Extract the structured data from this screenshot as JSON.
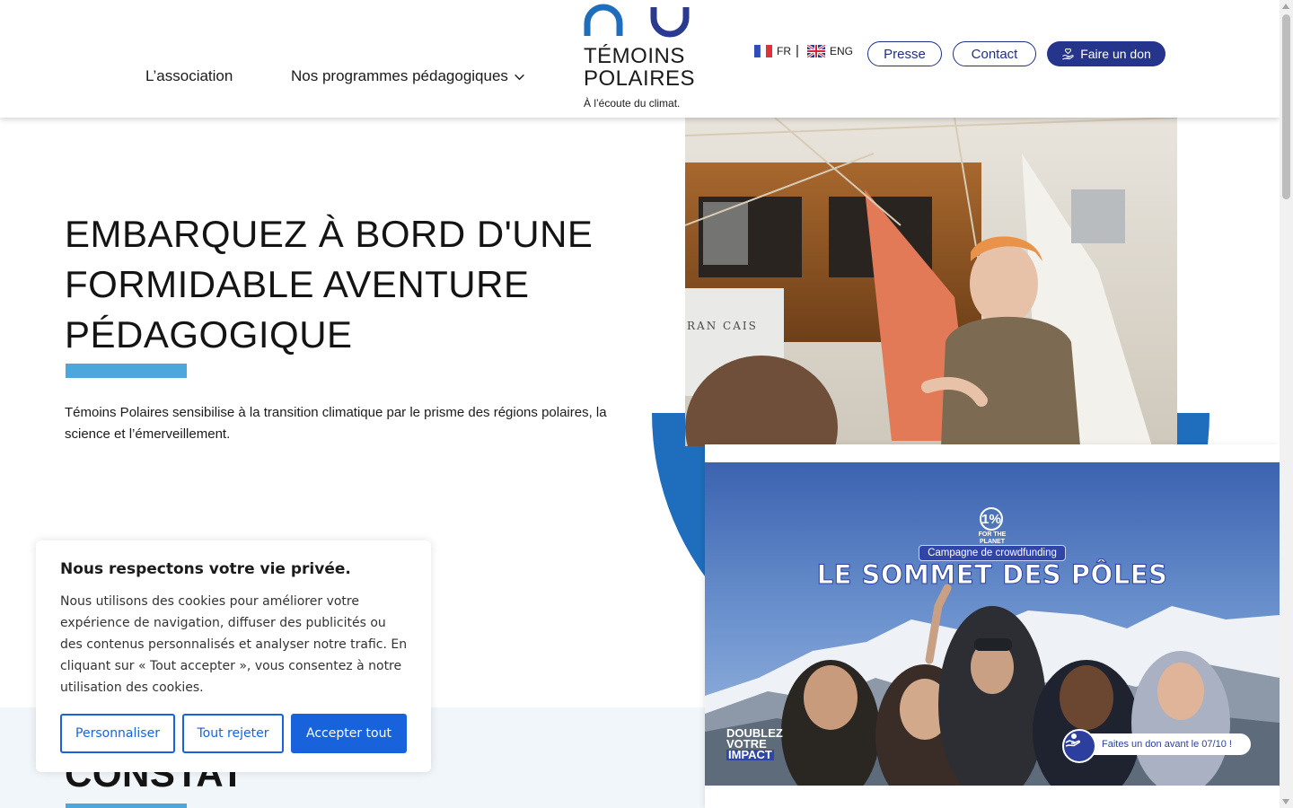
{
  "header": {
    "nav": {
      "association": "L’association",
      "programmes": "Nos programmes pédagogiques"
    },
    "logo": {
      "line1": "TÉMOINS",
      "line2": "POLAIRES",
      "tagline": "À l’écoute du climat."
    },
    "languages": {
      "fr": "FR",
      "separator": "|",
      "en": "ENG"
    },
    "buttons": {
      "presse": "Presse",
      "contact": "Contact",
      "don": "Faire un don"
    }
  },
  "hero": {
    "title_lines": [
      "EMBARQUEZ À BORD D'UNE",
      "FORMIDABLE AVENTURE",
      "PÉDAGOGIQUE"
    ],
    "text": "Témoins Polaires sensibilise à la transition climatique par le prisme des régions polaires, la science et l’émerveillement.",
    "photo_text": "RAN CAIS"
  },
  "section2": {
    "title": "CONSTAT"
  },
  "cookie_banner": {
    "title": "Nous respectons votre vie privée.",
    "text": "Nous utilisons des cookies pour améliorer votre expérience de navigation, diffuser des publicités ou des contenus personnalisés et analyser notre trafic. En cliquant sur « Tout accepter », vous consentez à notre utilisation des cookies.",
    "buttons": {
      "customize": "Personnaliser",
      "reject": "Tout rejeter",
      "accept": "Accepter tout"
    }
  },
  "popup": {
    "banner": {
      "logo_mark": "1%",
      "logo_text": "FOR THE PLANET",
      "pill": "Campagne de crowdfunding",
      "title": "LE SOMMET DES PÔLES",
      "double_line1": "DOUBLEZ",
      "double_line2": "VOTRE",
      "double_line3": "IMPACT",
      "cta": "Faites un don avant le 07/10 !"
    }
  },
  "colors": {
    "navy": "#25358c",
    "accent_blue": "#4da7dc",
    "arc_blue": "#1f6dbd",
    "cookie_blue": "#1863dc"
  }
}
